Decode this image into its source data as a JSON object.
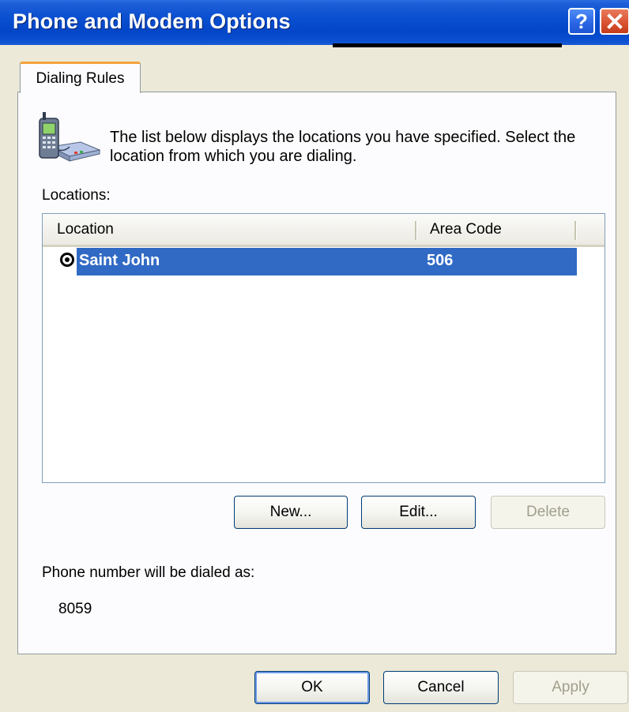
{
  "window": {
    "title": "Phone and Modem Options",
    "help_glyph": "?",
    "close_icon": "close-icon"
  },
  "tabs": [
    {
      "label": "Dialing Rules",
      "active": true
    }
  ],
  "dialing_rules": {
    "description": "The list below displays the locations you have specified. Select the location from which you are dialing.",
    "locations_label": "Locations:",
    "columns": [
      "Location",
      "Area Code"
    ],
    "rows": [
      {
        "location": "Saint John",
        "area_code": "506",
        "selected": true
      }
    ],
    "buttons": {
      "new": "New...",
      "edit": "Edit...",
      "delete": "Delete"
    },
    "dialed_as_label": "Phone number will be dialed as:",
    "dialed_as_value": "8059"
  },
  "dialog_buttons": {
    "ok": "OK",
    "cancel": "Cancel",
    "apply": "Apply"
  },
  "colors": {
    "titlebar": "#0a4fd0",
    "selection": "#316ac5",
    "tab_accent": "#f3a33a",
    "dialog_bg": "#ece9d8"
  }
}
